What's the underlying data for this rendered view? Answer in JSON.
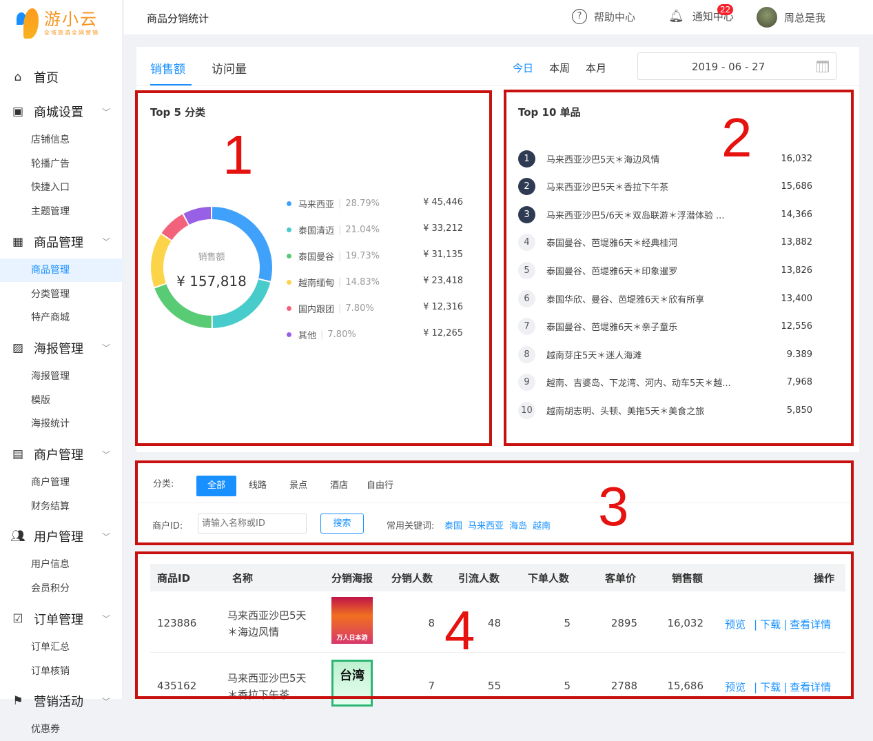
{
  "brand": {
    "name": "游小云",
    "slogan": "全域旅游全网营销"
  },
  "header": {
    "title": "商品分销统计",
    "help": "帮助中心",
    "notify": "通知中心",
    "notify_badge": "22",
    "user": "周总是我"
  },
  "sidebar": [
    {
      "type": "group",
      "label": "首页",
      "icon": "home-icon"
    },
    {
      "type": "group",
      "label": "商城设置",
      "icon": "shop-icon"
    },
    {
      "type": "sub",
      "label": "店铺信息"
    },
    {
      "type": "sub",
      "label": "轮播广告"
    },
    {
      "type": "sub",
      "label": "快捷入口"
    },
    {
      "type": "sub",
      "label": "主题管理"
    },
    {
      "type": "group",
      "label": "商品管理",
      "icon": "grid-icon"
    },
    {
      "type": "sub",
      "label": "商品管理",
      "active": true
    },
    {
      "type": "sub",
      "label": "分类管理"
    },
    {
      "type": "sub",
      "label": "特产商城"
    },
    {
      "type": "group",
      "label": "海报管理",
      "icon": "image-icon"
    },
    {
      "type": "sub",
      "label": "海报管理"
    },
    {
      "type": "sub",
      "label": "模版"
    },
    {
      "type": "sub",
      "label": "海报统计"
    },
    {
      "type": "group",
      "label": "商户管理",
      "icon": "store-icon"
    },
    {
      "type": "sub",
      "label": "商户管理"
    },
    {
      "type": "sub",
      "label": "财务结算"
    },
    {
      "type": "group",
      "label": "用户管理",
      "icon": "users-icon"
    },
    {
      "type": "sub",
      "label": "用户信息"
    },
    {
      "type": "sub",
      "label": "会员积分"
    },
    {
      "type": "group",
      "label": "订单管理",
      "icon": "checkbox-icon"
    },
    {
      "type": "sub",
      "label": "订单汇总"
    },
    {
      "type": "sub",
      "label": "订单核销"
    },
    {
      "type": "group",
      "label": "营销活动",
      "icon": "flag-icon"
    },
    {
      "type": "sub",
      "label": "优惠券"
    }
  ],
  "tabs": {
    "sales": "销售额",
    "visits": "访问量"
  },
  "range": {
    "today": "今日",
    "week": "本周",
    "month": "本月",
    "date": "2019 - 06 - 27"
  },
  "top5": {
    "title": "Top 5 分类",
    "center_label": "销售额",
    "total": "¥ 157,818",
    "items": [
      {
        "name": "马来西亚",
        "pct": "28.79%",
        "amount": "¥ 45,446",
        "value": 28.79,
        "color": "#40a1fb"
      },
      {
        "name": "泰国清迈",
        "pct": "21.04%",
        "amount": "¥ 33,212",
        "value": 21.04,
        "color": "#47cbcb"
      },
      {
        "name": "泰国曼谷",
        "pct": "19.73%",
        "amount": "¥ 31,135",
        "value": 19.73,
        "color": "#59cb74"
      },
      {
        "name": "越南缅甸",
        "pct": "14.83%",
        "amount": "¥ 23,418",
        "value": 14.83,
        "color": "#fbd44a"
      },
      {
        "name": "国内跟团",
        "pct": "7.80%",
        "amount": "¥ 12,316",
        "value": 7.8,
        "color": "#f2637b"
      },
      {
        "name": "其他",
        "pct": "7.80%",
        "amount": "¥ 12,265",
        "value": 7.8,
        "color": "#9860e5"
      }
    ]
  },
  "top10": {
    "title": "Top 10 单品",
    "items": [
      {
        "rank": "1",
        "name": "马来西亚沙巴5天＊海边风情",
        "value": "16,032"
      },
      {
        "rank": "2",
        "name": "马来西亚沙巴5天＊香拉下午茶",
        "value": "15,686"
      },
      {
        "rank": "3",
        "name": "马来西亚沙巴5/6天＊双岛联游＊浮潜体验 ...",
        "value": "14,366"
      },
      {
        "rank": "4",
        "name": "泰国曼谷、芭堤雅6天＊经典桂河",
        "value": "13,882"
      },
      {
        "rank": "5",
        "name": "泰国曼谷、芭堤雅6天＊印象暹罗",
        "value": "13,826"
      },
      {
        "rank": "6",
        "name": "泰国华欣、曼谷、芭堤雅6天＊欣有所享",
        "value": "13,400"
      },
      {
        "rank": "7",
        "name": "泰国曼谷、芭堤雅6天＊亲子童乐",
        "value": "12,556"
      },
      {
        "rank": "8",
        "name": "越南芽庄5天＊迷人海滩",
        "value": "9.389"
      },
      {
        "rank": "9",
        "name": "越南、吉婆岛、下龙湾、河内、动车5天＊越...",
        "value": "7,968"
      },
      {
        "rank": "10",
        "name": "越南胡志明、头顿、美拖5天＊美食之旅",
        "value": "5,850"
      }
    ]
  },
  "filter": {
    "category_label": "分类:",
    "chips": [
      "全部",
      "线路",
      "景点",
      "酒店",
      "自由行"
    ],
    "merchant_label": "商户ID:",
    "merchant_placeholder": "请输入名称或ID",
    "search": "搜索",
    "keywords_label": "常用关键词:",
    "keywords": [
      "泰国",
      "马来西亚",
      "海岛",
      "越南"
    ]
  },
  "table": {
    "headers": [
      "商品ID",
      "名称",
      "分销海报",
      "分销人数",
      "引流人数",
      "下单人数",
      "客单价",
      "销售额",
      "操作"
    ],
    "actions": [
      "预览",
      "下载",
      "查看详情"
    ],
    "rows": [
      {
        "id": "123886",
        "name1": "马来西亚沙巴5天",
        "name2": "＊海边风情",
        "dist": "8",
        "traffic": "48",
        "orders": "5",
        "avg": "2895",
        "sales": "16,032",
        "poster_text": "万人日本游"
      },
      {
        "id": "435162",
        "name1": "马来西亚沙巴5天",
        "name2": "＊香拉下午茶",
        "dist": "7",
        "traffic": "55",
        "orders": "5",
        "avg": "2788",
        "sales": "15,686",
        "poster_text": "台湾"
      }
    ]
  },
  "annotations": [
    "1",
    "2",
    "3",
    "4"
  ]
}
